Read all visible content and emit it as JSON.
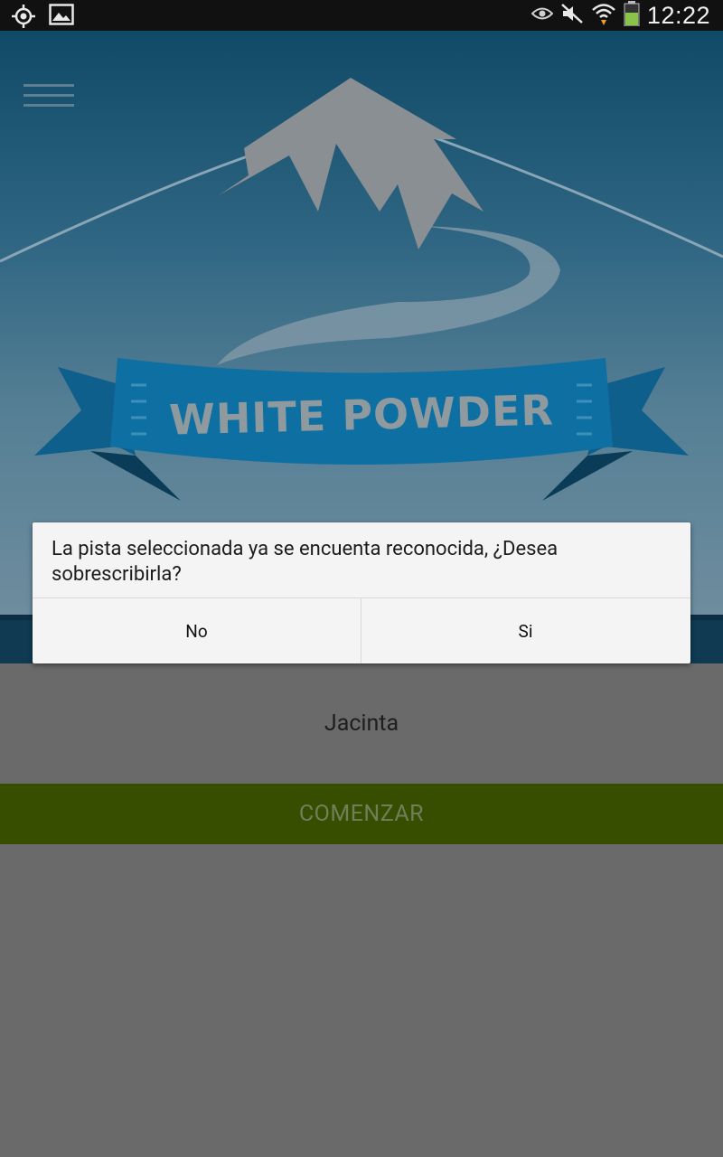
{
  "status_bar": {
    "time": "12:22",
    "icons": [
      "gps-icon",
      "image-icon",
      "eye-icon",
      "mute-icon",
      "wifi-icon",
      "battery-icon"
    ],
    "battery_color": "#8bc34a"
  },
  "hero": {
    "logo_text": "WHITE POWDER",
    "menu_icon": "hamburger-menu-icon"
  },
  "main": {
    "track_name": "Jacinta",
    "start_label": "COMENZAR"
  },
  "dialog": {
    "message": "La pista seleccionada ya se encuenta reconocida, ¿Desea sobrescribirla?",
    "no_label": "No",
    "yes_label": "Si"
  },
  "colors": {
    "accent_green": "#374d00",
    "ribbon_blue": "#0e6fa3",
    "hero_top": "#0f4a66"
  }
}
